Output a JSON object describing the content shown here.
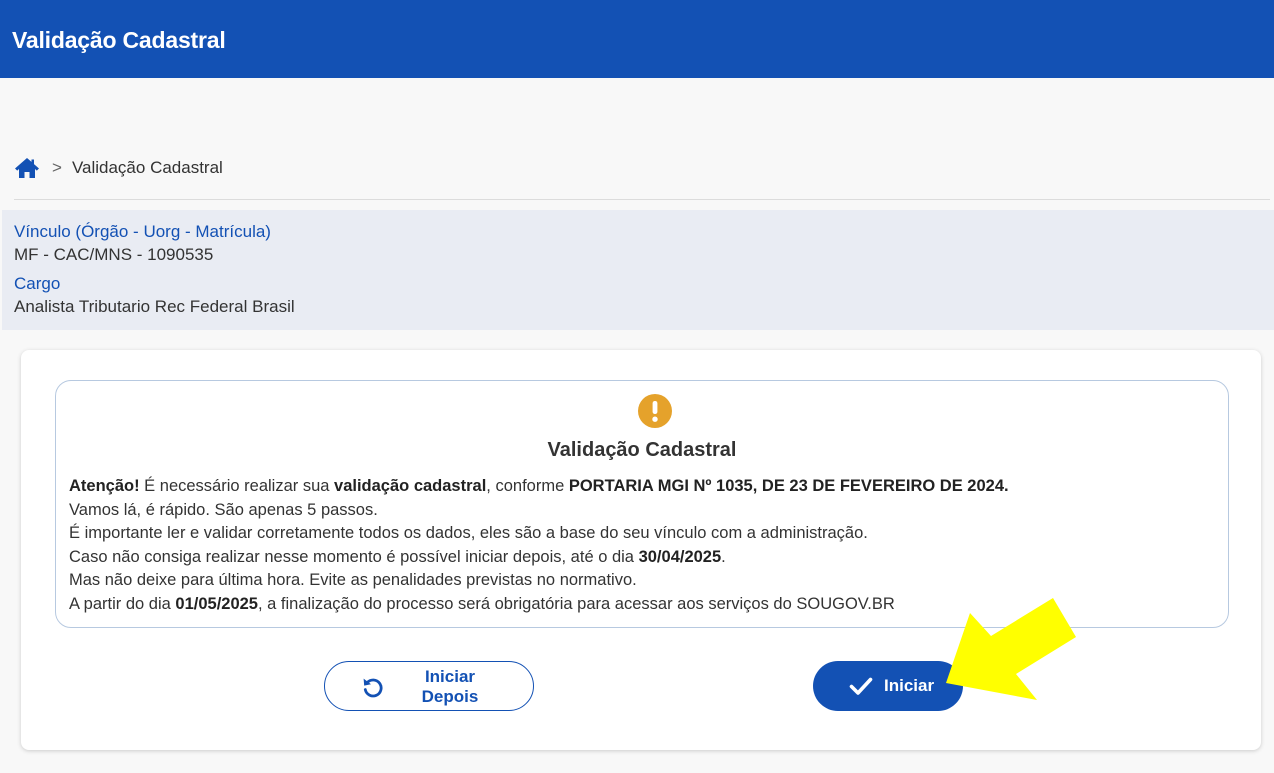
{
  "header": {
    "title": "Validação Cadastral",
    "background_color": "#1351b4"
  },
  "breadcrumb": {
    "home_icon": "home-icon",
    "separator": ">",
    "current": "Validação Cadastral"
  },
  "info": {
    "vinculo_label": "Vínculo (Órgão - Uorg - Matrícula)",
    "vinculo_value": "MF - CAC/MNS - 1090535",
    "cargo_label": "Cargo",
    "cargo_value": "Analista Tributario Rec Federal Brasil"
  },
  "notice": {
    "icon": "exclamation-circle-icon",
    "icon_color": "#e5a22b",
    "title": "Validação Cadastral",
    "line1": {
      "attention": "Atenção!",
      "text_a": " É necessário realizar sua ",
      "bold_a": "validação cadastral",
      "text_b": ", conforme ",
      "bold_b": "PORTARIA MGI Nº 1035, DE 23 DE FEVEREIRO DE 2024."
    },
    "line2": "Vamos lá, é rápido. São apenas 5 passos.",
    "line3": "É importante ler e validar corretamente todos os dados, eles são a base do seu vínculo com a administração.",
    "line4": {
      "text_a": "Caso não consiga realizar nesse momento é possível iniciar depois, até o dia ",
      "bold_date": "30/04/2025",
      "text_b": "."
    },
    "line5": "Mas não deixe para última hora. Evite as penalidades previstas no normativo.",
    "line6": {
      "text_a": "A partir do dia ",
      "bold_date": "01/05/2025",
      "text_b": ", a finalização do processo será obrigatória para acessar aos serviços do SOUGOV.BR"
    }
  },
  "buttons": {
    "later_line1": "Iniciar",
    "later_line2": "Depois",
    "later_icon": "undo-icon",
    "start_label": "Iniciar",
    "start_icon": "check-icon"
  },
  "annotation": {
    "arrow_icon": "yellow-arrow-icon",
    "arrow_color": "#ffff00"
  }
}
